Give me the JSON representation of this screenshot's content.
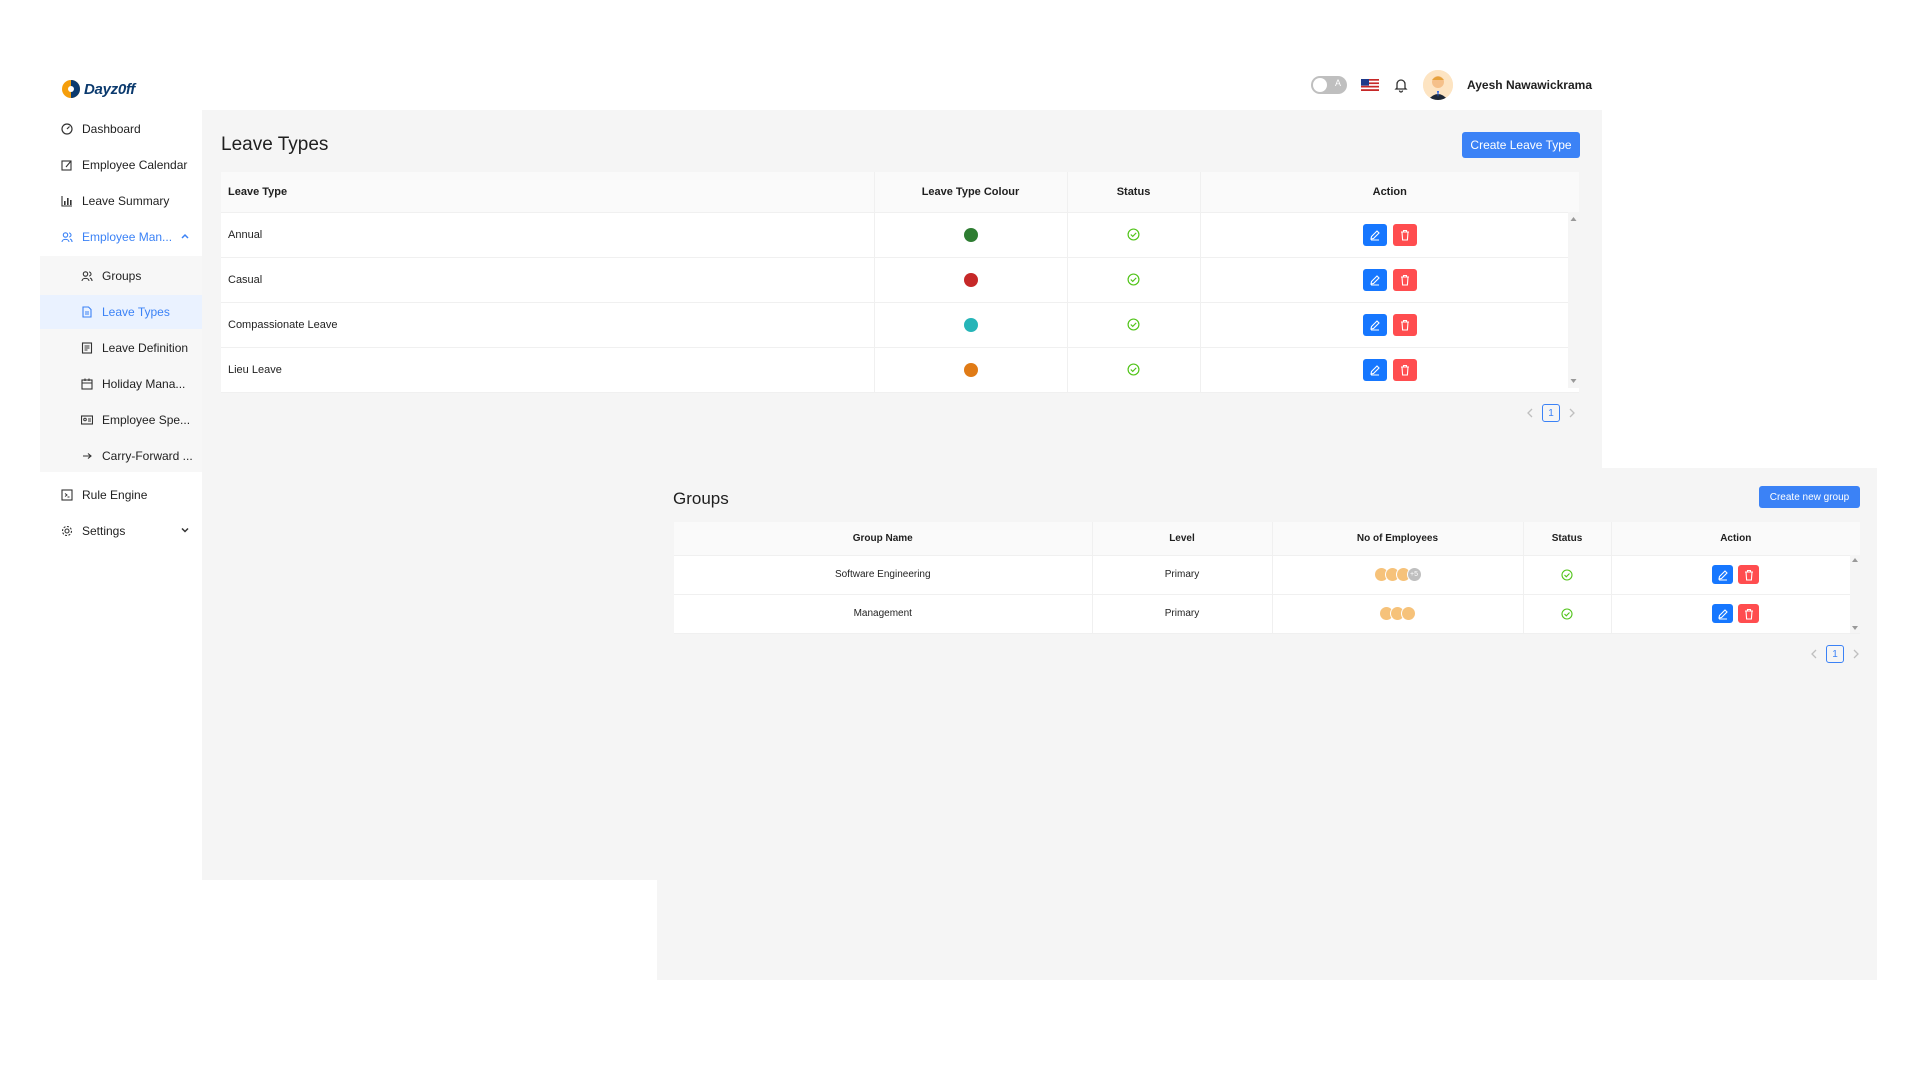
{
  "app": {
    "logo_text": "Dayz0ff"
  },
  "header": {
    "toggle_label": "A",
    "username": "Ayesh Nawawickrama"
  },
  "sidebar": {
    "items": [
      {
        "label": "Dashboard",
        "icon": "dashboard-icon"
      },
      {
        "label": "Employee Calendar",
        "icon": "edit-calendar-icon"
      },
      {
        "label": "Leave Summary",
        "icon": "bar-chart-icon"
      },
      {
        "label": "Employee Man...",
        "icon": "users-icon"
      },
      {
        "label": "Groups",
        "icon": "group-icon"
      },
      {
        "label": "Leave Types",
        "icon": "file-icon"
      },
      {
        "label": "Leave Definition",
        "icon": "definition-icon"
      },
      {
        "label": "Holiday Mana...",
        "icon": "calendar-icon"
      },
      {
        "label": "Employee Spe...",
        "icon": "id-card-icon"
      },
      {
        "label": "Carry-Forward ...",
        "icon": "arrow-right-icon"
      },
      {
        "label": "Rule Engine",
        "icon": "code-icon"
      },
      {
        "label": "Settings",
        "icon": "gear-icon"
      }
    ]
  },
  "leave_types": {
    "title": "Leave Types",
    "create_label": "Create Leave Type",
    "columns": [
      "Leave Type",
      "Leave Type Colour",
      "Status",
      "Action"
    ],
    "rows": [
      {
        "name": "Annual",
        "colour": "#2e7d32"
      },
      {
        "name": "Casual",
        "colour": "#c62828"
      },
      {
        "name": "Compassionate Leave",
        "colour": "#26b5b8"
      },
      {
        "name": "Lieu Leave",
        "colour": "#e07b16"
      }
    ],
    "page": "1"
  },
  "groups": {
    "title": "Groups",
    "create_label": "Create new group",
    "columns": [
      "Group Name",
      "Level",
      "No of Employees",
      "Status",
      "Action"
    ],
    "rows": [
      {
        "name": "Software Engineering",
        "level": "Primary",
        "more": "+5"
      },
      {
        "name": "Management",
        "level": "Primary",
        "more": ""
      }
    ],
    "page": "1"
  },
  "colors": {
    "accent": "#3b82f6",
    "edit": "#1677ff",
    "delete": "#ff4d4f",
    "status_ok": "#52c41a"
  }
}
